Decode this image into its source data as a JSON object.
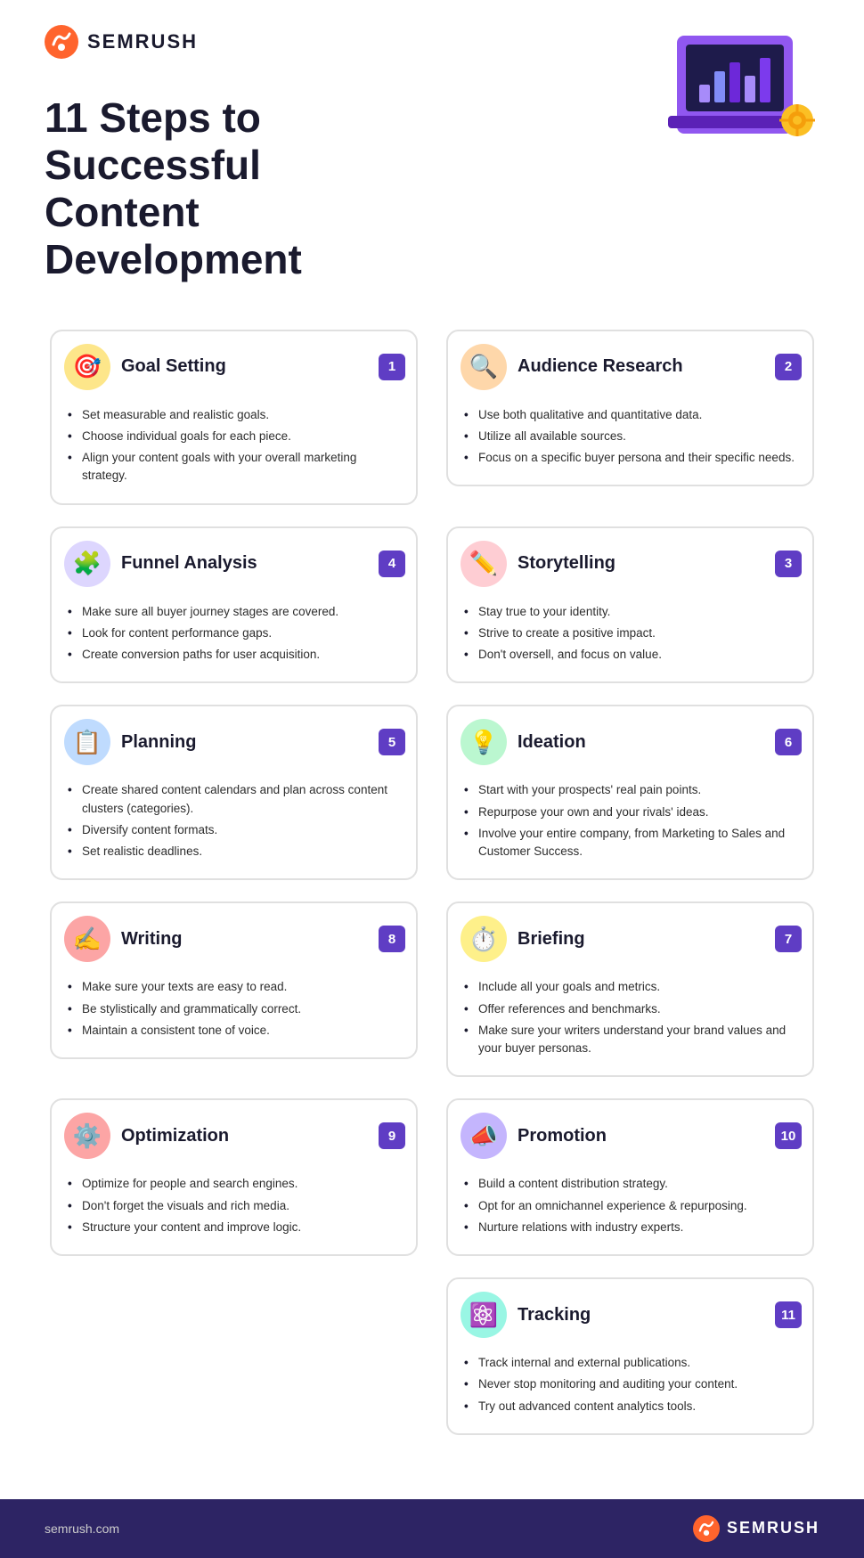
{
  "brand": {
    "name": "SEMRUSH",
    "website": "semrush.com"
  },
  "page": {
    "title": "11 Steps to Successful Content Development"
  },
  "steps": [
    {
      "id": 1,
      "number": "1",
      "title": "Goal Setting",
      "icon": "🎯",
      "iconBg": "icon-yellow",
      "position": "left",
      "bullets": [
        "Set measurable and realistic goals.",
        "Choose individual goals for each piece.",
        "Align your content goals with your overall marketing strategy."
      ]
    },
    {
      "id": 2,
      "number": "2",
      "title": "Audience Research",
      "icon": "🔍",
      "iconBg": "icon-orange",
      "position": "right",
      "bullets": [
        "Use both qualitative and quantitative data.",
        "Utilize all available sources.",
        "Focus on a specific buyer persona and their specific needs."
      ]
    },
    {
      "id": 4,
      "number": "4",
      "title": "Funnel Analysis",
      "icon": "🧩",
      "iconBg": "icon-purple",
      "position": "left",
      "bullets": [
        "Make sure all buyer journey stages are covered.",
        "Look for content performance gaps.",
        "Create conversion paths for user acquisition."
      ]
    },
    {
      "id": 3,
      "number": "3",
      "title": "Storytelling",
      "icon": "✏️",
      "iconBg": "icon-pink",
      "position": "right",
      "bullets": [
        "Stay true to your identity.",
        "Strive to create a positive impact.",
        "Don't oversell, and focus on value."
      ]
    },
    {
      "id": 5,
      "number": "5",
      "title": "Planning",
      "icon": "📋",
      "iconBg": "icon-blue",
      "position": "left",
      "bullets": [
        "Create shared content calendars and plan across content clusters (categories).",
        "Diversify content formats.",
        "Set realistic deadlines."
      ]
    },
    {
      "id": 6,
      "number": "6",
      "title": "Ideation",
      "icon": "💡",
      "iconBg": "icon-green",
      "position": "right",
      "bullets": [
        "Start with your prospects' real pain points.",
        "Repurpose your own and your rivals' ideas.",
        "Involve your entire company, from Marketing to Sales and Customer Success."
      ]
    },
    {
      "id": 8,
      "number": "8",
      "title": "Writing",
      "icon": "✍️",
      "iconBg": "icon-red",
      "position": "left",
      "bullets": [
        "Make sure your texts are easy to read.",
        "Be stylistically and grammatically correct.",
        "Maintain a consistent tone of voice."
      ]
    },
    {
      "id": 7,
      "number": "7",
      "title": "Briefing",
      "icon": "⏱️",
      "iconBg": "icon-yellow2",
      "position": "right",
      "bullets": [
        "Include all your goals and metrics.",
        "Offer references and benchmarks.",
        "Make sure your writers understand your brand values and your buyer personas."
      ]
    },
    {
      "id": 9,
      "number": "9",
      "title": "Optimization",
      "icon": "⚙️",
      "iconBg": "icon-salmon",
      "position": "left",
      "bullets": [
        "Optimize for people and search engines.",
        "Don't forget the visuals and rich media.",
        "Structure your content and improve logic."
      ]
    },
    {
      "id": 10,
      "number": "10",
      "title": "Promotion",
      "icon": "📣",
      "iconBg": "icon-violet",
      "position": "right",
      "bullets": [
        "Build a content distribution strategy.",
        "Opt for an omnichannel experience & repurposing.",
        "Nurture relations with industry experts."
      ]
    },
    {
      "id": 11,
      "number": "11",
      "title": "Tracking",
      "icon": "⚛️",
      "iconBg": "icon-teal",
      "position": "right",
      "bullets": [
        "Track internal and external publications.",
        "Never stop monitoring and auditing your content.",
        "Try out advanced content analytics tools."
      ]
    }
  ],
  "footer": {
    "url": "semrush.com",
    "brand": "SEMRUSH"
  }
}
